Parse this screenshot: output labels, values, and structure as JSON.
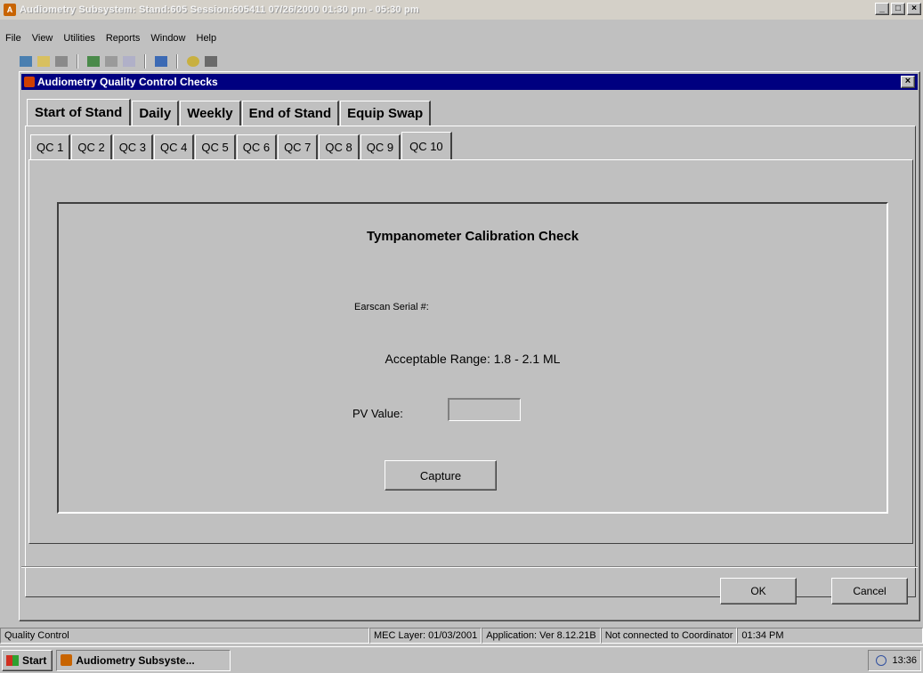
{
  "app": {
    "title": "Audiometry Subsystem: Stand:605 Session:605411 07/26/2000 01:30 pm - 05:30 pm",
    "menu": [
      "File",
      "View",
      "Utilities",
      "Reports",
      "Window",
      "Help"
    ]
  },
  "toolbar": {
    "icons": [
      "open-icon",
      "folder-icon",
      "save-icon",
      "people-icon",
      "print-icon",
      "calendar-icon",
      "chart-icon",
      "help-icon",
      "exit-icon"
    ]
  },
  "dialog": {
    "title": "Audiometry Quality Control Checks",
    "outer_tabs": [
      "Start of Stand",
      "Daily",
      "Weekly",
      "End of Stand",
      "Equip Swap"
    ],
    "outer_active": "Start of Stand",
    "inner_tabs": [
      "QC 1",
      "QC 2",
      "QC 3",
      "QC 4",
      "QC 5",
      "QC 6",
      "QC 7",
      "QC 8",
      "QC 9",
      "QC 10"
    ],
    "inner_active": "QC 10",
    "section_title": "Tympanometer Calibration Check",
    "serial_label": "Earscan Serial #:",
    "range_label": "Acceptable Range: 1.8 - 2.1 ML",
    "pv_label": "PV Value:",
    "pv_value": "",
    "capture_label": "Capture",
    "ok_label": "OK",
    "cancel_label": "Cancel"
  },
  "status": {
    "left": "Quality Control",
    "mec_layer": "MEC Layer: 01/03/2001",
    "application": "Application: Ver 8.12.21B",
    "connection": "Not connected to Coordinator",
    "time": "01:34 PM"
  },
  "taskbar": {
    "start_label": "Start",
    "task_label": "Audiometry Subsyste...",
    "clock": "13:36"
  }
}
